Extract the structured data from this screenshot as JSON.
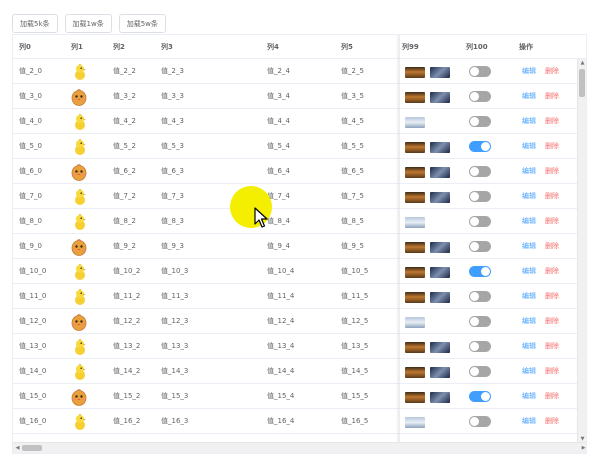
{
  "toolbar": {
    "buttons": [
      "加载5k条",
      "加载1w条",
      "加载5w条"
    ]
  },
  "table": {
    "columns": [
      "列0",
      "列1",
      "列2",
      "列3",
      "列4",
      "列5",
      "列99",
      "列100",
      "操作"
    ],
    "rows": [
      {
        "c0": "值_2_0",
        "c2": "值_2_2",
        "c3": "值_2_3",
        "c4": "值_2_4",
        "c5": "值_2_5",
        "avatar": "chick-small",
        "thumbs": [
          "sunset",
          "dark"
        ],
        "switch_on": false
      },
      {
        "c0": "值_3_0",
        "c2": "值_3_2",
        "c3": "值_3_3",
        "c4": "值_3_4",
        "c5": "值_3_5",
        "avatar": "chick-big",
        "thumbs": [
          "sunset",
          "dark"
        ],
        "switch_on": false
      },
      {
        "c0": "值_4_0",
        "c2": "值_4_2",
        "c3": "值_4_3",
        "c4": "值_4_4",
        "c5": "值_4_5",
        "avatar": "chick-small",
        "thumbs": [
          "city"
        ],
        "switch_on": false
      },
      {
        "c0": "值_5_0",
        "c2": "值_5_2",
        "c3": "值_5_3",
        "c4": "值_5_4",
        "c5": "值_5_5",
        "avatar": "chick-small",
        "thumbs": [
          "sunset",
          "dark"
        ],
        "switch_on": true
      },
      {
        "c0": "值_6_0",
        "c2": "值_6_2",
        "c3": "值_6_3",
        "c4": "值_6_4",
        "c5": "值_6_5",
        "avatar": "chick-big",
        "thumbs": [
          "sunset",
          "dark"
        ],
        "switch_on": false
      },
      {
        "c0": "值_7_0",
        "c2": "值_7_2",
        "c3": "值_7_3",
        "c4": "值_7_4",
        "c5": "值_7_5",
        "avatar": "chick-small",
        "thumbs": [
          "sunset",
          "dark"
        ],
        "switch_on": false
      },
      {
        "c0": "值_8_0",
        "c2": "值_8_2",
        "c3": "值_8_3",
        "c4": "值_8_4",
        "c5": "值_8_5",
        "avatar": "chick-small",
        "thumbs": [
          "city"
        ],
        "switch_on": false
      },
      {
        "c0": "值_9_0",
        "c2": "值_9_2",
        "c3": "值_9_3",
        "c4": "值_9_4",
        "c5": "值_9_5",
        "avatar": "chick-big",
        "thumbs": [
          "sunset",
          "dark"
        ],
        "switch_on": false
      },
      {
        "c0": "值_10_0",
        "c2": "值_10_2",
        "c3": "值_10_3",
        "c4": "值_10_4",
        "c5": "值_10_5",
        "avatar": "chick-small",
        "thumbs": [
          "sunset",
          "dark"
        ],
        "switch_on": true
      },
      {
        "c0": "值_11_0",
        "c2": "值_11_2",
        "c3": "值_11_3",
        "c4": "值_11_4",
        "c5": "值_11_5",
        "avatar": "chick-small",
        "thumbs": [
          "sunset",
          "dark"
        ],
        "switch_on": false
      },
      {
        "c0": "值_12_0",
        "c2": "值_12_2",
        "c3": "值_12_3",
        "c4": "值_12_4",
        "c5": "值_12_5",
        "avatar": "chick-big",
        "thumbs": [
          "city"
        ],
        "switch_on": false
      },
      {
        "c0": "值_13_0",
        "c2": "值_13_2",
        "c3": "值_13_3",
        "c4": "值_13_4",
        "c5": "值_13_5",
        "avatar": "chick-small",
        "thumbs": [
          "sunset",
          "dark"
        ],
        "switch_on": false
      },
      {
        "c0": "值_14_0",
        "c2": "值_14_2",
        "c3": "值_14_3",
        "c4": "值_14_4",
        "c5": "值_14_5",
        "avatar": "chick-small",
        "thumbs": [
          "sunset",
          "dark"
        ],
        "switch_on": false
      },
      {
        "c0": "值_15_0",
        "c2": "值_15_2",
        "c3": "值_15_3",
        "c4": "值_15_4",
        "c5": "值_15_5",
        "avatar": "chick-big",
        "thumbs": [
          "sunset",
          "dark"
        ],
        "switch_on": true
      },
      {
        "c0": "值_16_0",
        "c2": "值_16_2",
        "c3": "值_16_3",
        "c4": "值_16_4",
        "c5": "值_16_5",
        "avatar": "chick-small",
        "thumbs": [
          "city"
        ],
        "switch_on": false
      }
    ],
    "actions": {
      "edit_label": "编辑",
      "delete_label": "删除"
    }
  },
  "colors": {
    "accent": "#409eff",
    "danger": "#f56c6c",
    "switch_off": "#a6a6a6",
    "cursor_highlight": "#f4ee00"
  },
  "icons": {
    "avatar": "chick-icon",
    "cursor": "mouse-pointer-icon"
  }
}
